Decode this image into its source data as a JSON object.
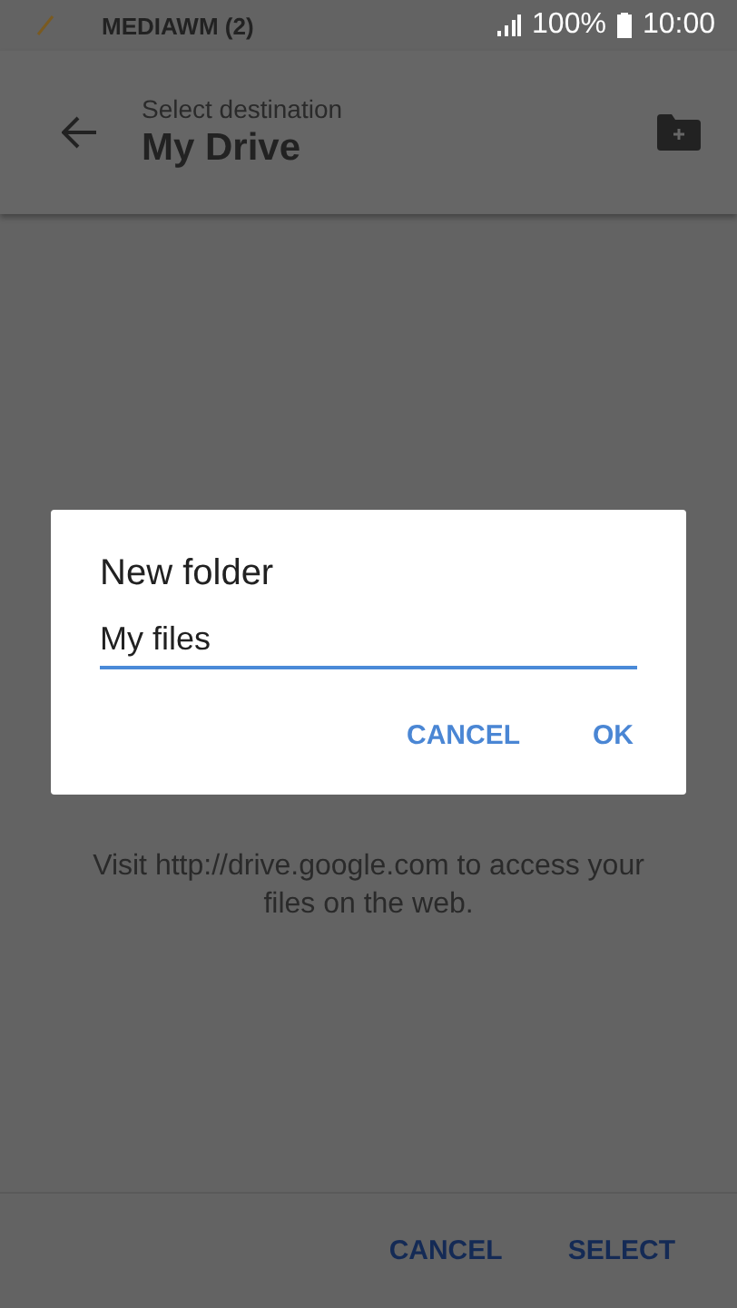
{
  "status_bar": {
    "notification": "MEDIAWM (2)",
    "battery": "100%",
    "time": "10:00"
  },
  "app_bar": {
    "subtitle": "Select destination",
    "title": "My Drive"
  },
  "empty_message": "Visit http://drive.google.com to access your files on the web.",
  "dialog": {
    "title": "New folder",
    "field": {
      "value": "My files"
    },
    "buttons": [
      "CANCEL",
      "OK"
    ]
  },
  "bottom_bar": {
    "buttons": [
      "CANCEL",
      "SELECT"
    ]
  }
}
